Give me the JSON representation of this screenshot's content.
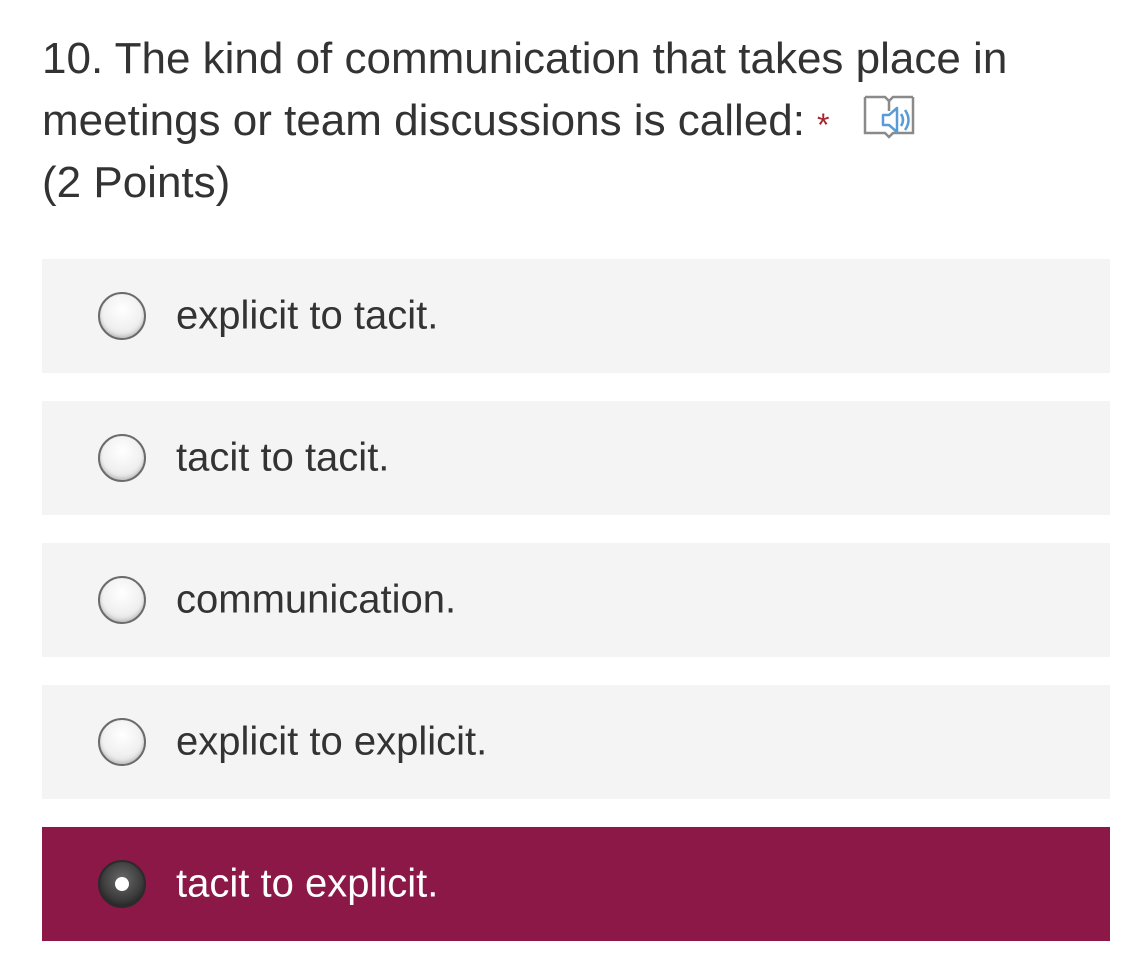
{
  "question": {
    "line1": "10. The kind of communication that takes place in",
    "line2": "meetings or team discussions is called:",
    "required_mark": "*",
    "points": "(2 Points)",
    "reader_icon": "immersive-reader-icon"
  },
  "options": [
    {
      "label": "explicit to tacit.",
      "selected": false
    },
    {
      "label": "tacit to tacit.",
      "selected": false
    },
    {
      "label": "communication.",
      "selected": false
    },
    {
      "label": "explicit to explicit.",
      "selected": false
    },
    {
      "label": "tacit to explicit.",
      "selected": true
    }
  ],
  "colors": {
    "selected_background": "#8c1847",
    "option_background": "#f4f4f4",
    "required_star": "#a4262c",
    "text": "#333333"
  }
}
